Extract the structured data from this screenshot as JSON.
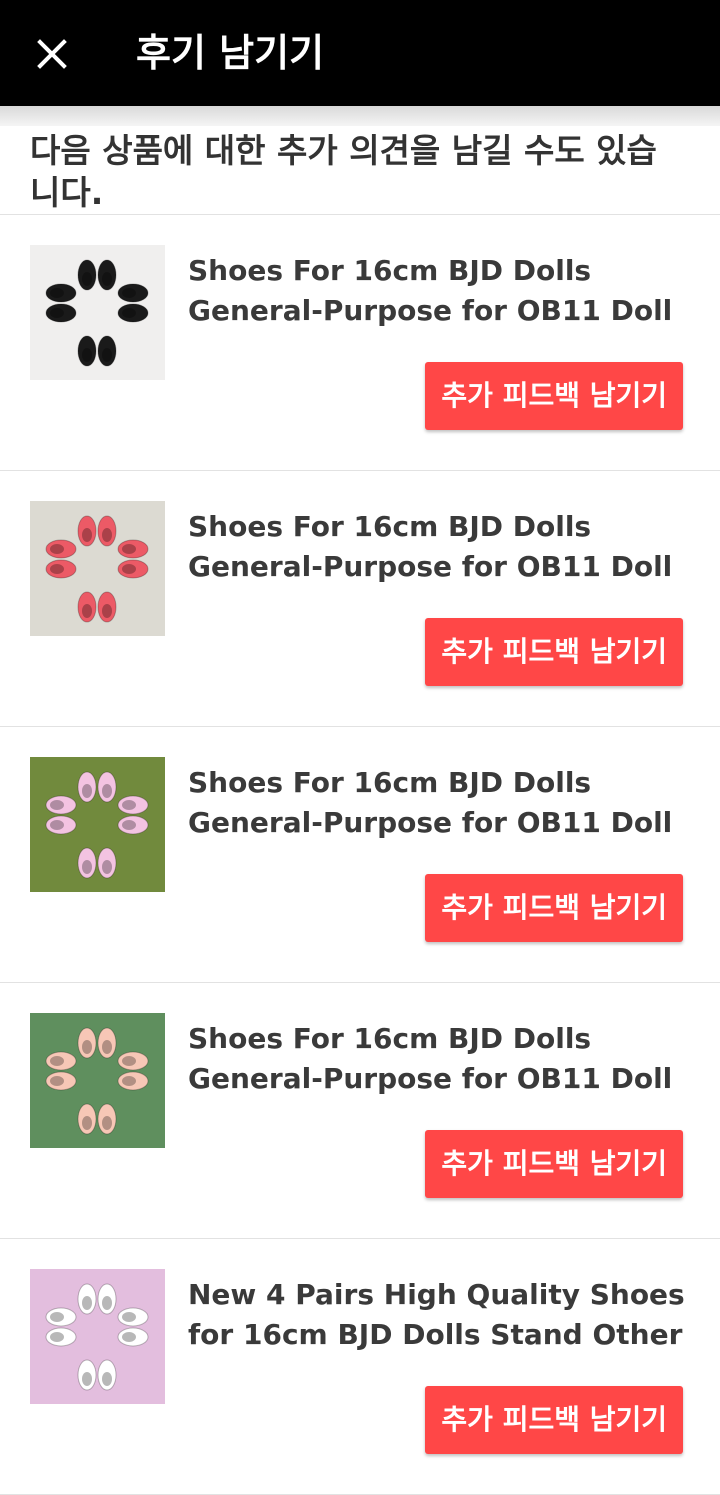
{
  "header": {
    "title": "후기 남기기",
    "close_icon": "close-icon",
    "background": "#000000"
  },
  "intro_text": "다음 상품에 대한 추가 의견을 남길 수도 있습니다.",
  "accent_color": "#ff4747",
  "products": [
    {
      "title": "Shoes For 16cm BJD Dolls General-Purpose for OB11 Doll",
      "button_label": "추가 피드백 남기기",
      "thumbnail_bg": "#f0efee",
      "shoe_color": "#1a1a1a"
    },
    {
      "title": "Shoes For 16cm BJD Dolls General-Purpose for OB11 Doll",
      "button_label": "추가 피드백 남기기",
      "thumbnail_bg": "#dcdad2",
      "shoe_color": "#ec5a66"
    },
    {
      "title": "Shoes For 16cm BJD Dolls General-Purpose for OB11 Doll",
      "button_label": "추가 피드백 남기기",
      "thumbnail_bg": "#718a3d",
      "shoe_color": "#f3c3e1"
    },
    {
      "title": "Shoes For 16cm BJD Dolls General-Purpose for OB11 Doll",
      "button_label": "추가 피드백 남기기",
      "thumbnail_bg": "#5f8f5e",
      "shoe_color": "#f7c7b6"
    },
    {
      "title": "New 4 Pairs High Quality Shoes for 16cm BJD Dolls Stand Other",
      "button_label": "추가 피드백 남기기",
      "thumbnail_bg": "#e3bede",
      "shoe_color": "#ffffff"
    }
  ]
}
